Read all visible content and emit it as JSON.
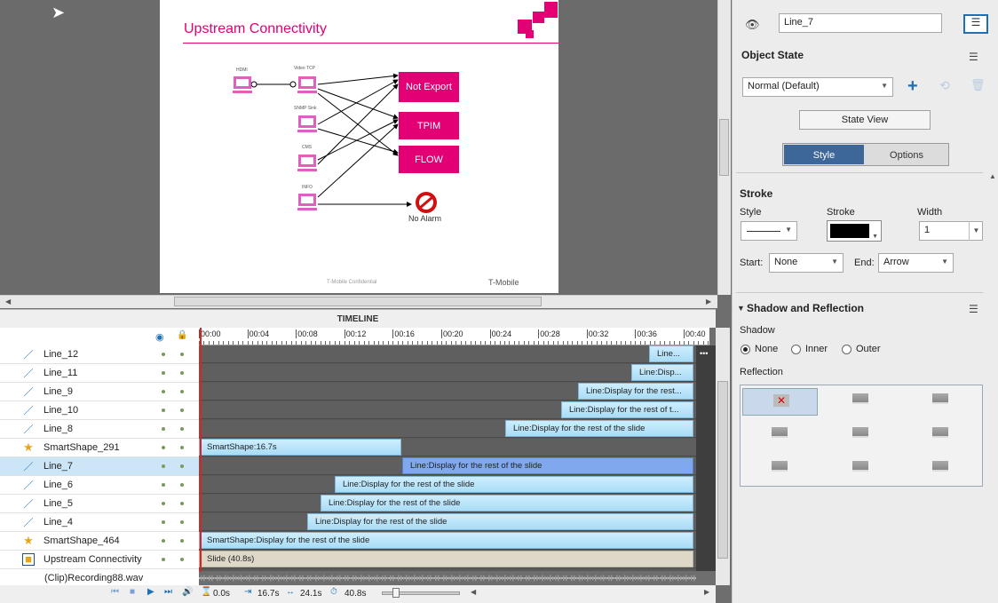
{
  "slide": {
    "title": "Upstream Connectivity",
    "labels": [
      "HDMI",
      "Video TCP",
      "SNMP Sink",
      "CMS",
      "INFO"
    ],
    "boxes": [
      "Not Export",
      "TPIM",
      "FLOW"
    ],
    "no_alarm": "No Alarm",
    "footer_left": "T-Mobile Confidential",
    "footer_right": "T-Mobile"
  },
  "timeline": {
    "header": "TIMELINE",
    "ruler": [
      "00:00",
      "00:04",
      "00:08",
      "00:12",
      "00:16",
      "00:20",
      "00:24",
      "00:28",
      "00:32",
      "00:36",
      "00:40"
    ],
    "rows": [
      {
        "name": "Line_12",
        "icon": "line-icon",
        "bar": "Line..."
      },
      {
        "name": "Line_11",
        "icon": "line-icon",
        "bar": "Line:Disp..."
      },
      {
        "name": "Line_9",
        "icon": "line-icon",
        "bar": "Line:Display for the rest..."
      },
      {
        "name": "Line_10",
        "icon": "line-icon",
        "bar": "Line:Display for the rest of t..."
      },
      {
        "name": "Line_8",
        "icon": "line-icon",
        "bar": "Line:Display for the rest of the slide"
      },
      {
        "name": "SmartShape_291",
        "icon": "star-icon",
        "bar": "SmartShape:16.7s"
      },
      {
        "name": "Line_7",
        "icon": "line-icon",
        "bar": "Line:Display for the rest of the slide"
      },
      {
        "name": "Line_6",
        "icon": "line-icon",
        "bar": "Line:Display for the rest of the slide"
      },
      {
        "name": "Line_5",
        "icon": "line-icon",
        "bar": "Line:Display for the rest of the slide"
      },
      {
        "name": "Line_4",
        "icon": "line-icon",
        "bar": "Line:Display for the rest of the slide"
      },
      {
        "name": "SmartShape_464",
        "icon": "star-icon",
        "bar": "SmartShape:Display for the rest of the slide"
      },
      {
        "name": "Upstream Connectivity",
        "icon": "slide-icon",
        "bar": "Slide (40.8s)"
      }
    ],
    "audio": "(Clip)Recording88.wav",
    "status": {
      "current": "0.0s",
      "start": "16.7s",
      "duration": "24.1s",
      "total": "40.8s"
    }
  },
  "panel": {
    "object_name": "Line_7",
    "object_state_label": "Object State",
    "state_value": "Normal (Default)",
    "state_view_btn": "State View",
    "tabs": [
      "Style",
      "Options"
    ],
    "stroke_section": "Stroke",
    "style_label": "Style",
    "stroke_label": "Stroke",
    "width_label": "Width",
    "width_value": "1",
    "start_label": "Start:",
    "start_value": "None",
    "end_label": "End:",
    "end_value": "Arrow",
    "shadow_section": "Shadow and Reflection",
    "shadow_label": "Shadow",
    "shadow_options": [
      "None",
      "Inner",
      "Outer"
    ],
    "reflection_label": "Reflection",
    "colors": {
      "accent": "#e20074",
      "selected_bar": "#7fa8ef",
      "bar": "#bfe6fa"
    }
  }
}
